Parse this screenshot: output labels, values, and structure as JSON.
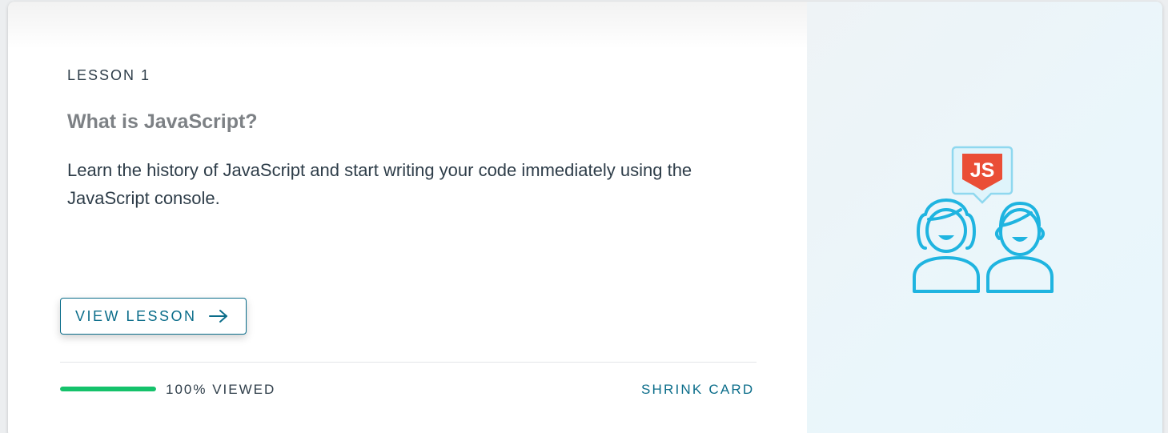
{
  "lesson": {
    "number_label": "LESSON 1",
    "title": "What is JavaScript?",
    "description": "Learn the history of JavaScript and start writing your code immediately using the JavaScript console."
  },
  "actions": {
    "view_lesson_label": "VIEW LESSON",
    "shrink_card_label": "SHRINK CARD"
  },
  "progress": {
    "value": 1.0,
    "label": "100% VIEWED"
  },
  "illustration": {
    "icon": "js-chat-people-icon",
    "badge_text": "JS"
  },
  "colors": {
    "accent": "#0b6d8a",
    "progress": "#15c26b",
    "illustration_primary": "#1fb4e0",
    "badge": "#ea4e36"
  }
}
